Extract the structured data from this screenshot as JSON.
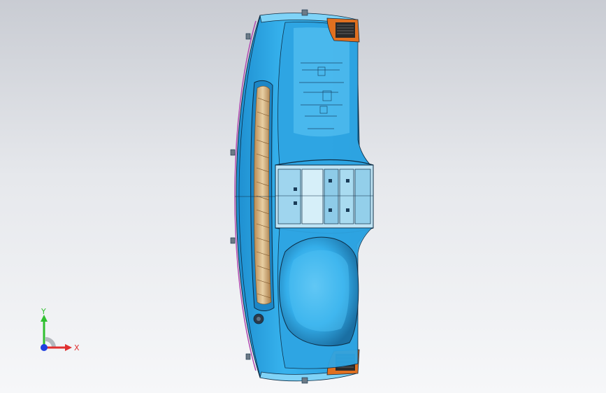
{
  "viewport": {
    "background_top": "#c9ccd3",
    "background_bottom": "#f6f7f9"
  },
  "model": {
    "body_color": "#2fa9e6",
    "highlight_color": "#7fd3f7",
    "shadow_color": "#1a6fa3",
    "edge_color": "#0d2c44",
    "vent_color": "#d9b889",
    "panel_color": "#bfe4f5",
    "accent_color": "#e07020",
    "trim_color": "#b04cb0"
  },
  "triad": {
    "x_label": "X",
    "y_label": "Y",
    "x_color": "#e03030",
    "y_color": "#30c030",
    "z_color": "#2040e0"
  }
}
